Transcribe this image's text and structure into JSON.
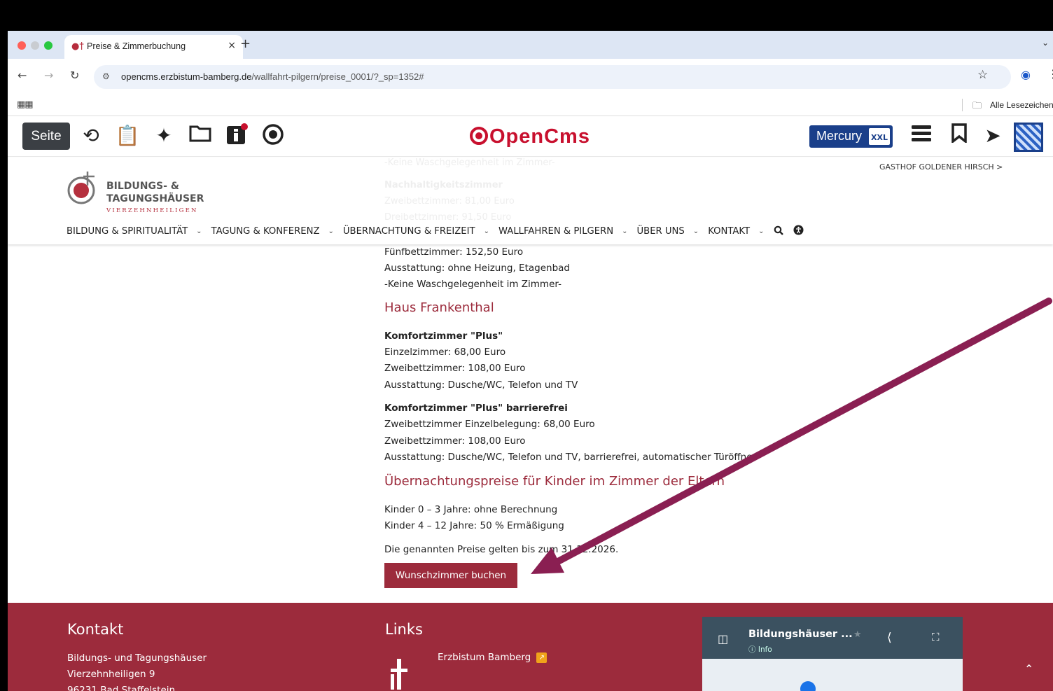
{
  "browser": {
    "tab_title": "Preise & Zimmerbuchung",
    "tab_close": "×",
    "new_tab": "+",
    "url_host": "opencms.erzbistum-bamberg.de",
    "url_path": "/wallfahrt-pilgern/preise_0001/?_sp=1352#",
    "bookmarks_label": "Alle Lesezeichen"
  },
  "cms_toolbar": {
    "seite_label": "Seite",
    "logo_text": "OpenCms",
    "mercury_label": "Mercury",
    "mercury_badge": "XXL"
  },
  "site_header": {
    "logo_line1": "BILDUNGS- &",
    "logo_line2": "TAGUNGSHÄUSER",
    "logo_line3": "VIERZEHNHEILIGEN",
    "gasthof_link": "GASTHOF GOLDENER HIRSCH >",
    "ghost_lines": [
      "-Keine Waschgelegenheit im Zimmer-",
      "Nachhaltigkeitszimmer",
      "Zweibettzimmer: 81,00 Euro",
      "Dreibettzimmer: 91,50 Euro"
    ],
    "nav": [
      "BILDUNG & SPIRITUALITÄT",
      "TAGUNG & KONFERENZ",
      "ÜBERNACHTUNG & FREIZEIT",
      "WALLFAHREN & PILGERN",
      "ÜBER UNS",
      "KONTAKT"
    ]
  },
  "content": {
    "line1": "Fünfbettzimmer: 152,50 Euro",
    "line2": "Ausstattung: ohne Heizung, Etagenbad",
    "line3": "-Keine Waschgelegenheit im Zimmer-",
    "heading_frankenthal": "Haus Frankenthal",
    "plus_title": "Komfortzimmer \"Plus\"",
    "plus_line1": "Einzelzimmer: 68,00 Euro",
    "plus_line2": "Zweibettzimmer: 108,00 Euro",
    "plus_line3": "Ausstattung: Dusche/WC, Telefon und TV",
    "bf_title": "Komfortzimmer \"Plus\" barrierefrei",
    "bf_line1": "Zweibettzimmer Einzelbelegung: 68,00 Euro",
    "bf_line2": "Zweibettzimmer: 108,00 Euro",
    "bf_line3": "Ausstattung: Dusche/WC, Telefon und TV, barrierefrei, automatischer Türöffner",
    "heading_kinder": "Übernachtungspreise für Kinder im Zimmer der Eltern",
    "kinder_line1": "Kinder 0 – 3 Jahre: ohne Berechnung",
    "kinder_line2": "Kinder 4 – 12 Jahre: 50 % Ermäßigung",
    "validity": "Die genannten Preise gelten bis zum 31.12.2026.",
    "book_button": "Wunschzimmer buchen"
  },
  "footer": {
    "kontakt_heading": "Kontakt",
    "addr1": "Bildungs- und Tagungshäuser",
    "addr2": "Vierzehnheiligen 9",
    "addr3": "96231 Bad Staffelstein",
    "links_heading": "Links",
    "link1": "Erzbistum Bamberg",
    "map_title": "Bildungshäuser ...",
    "map_info": "Info"
  },
  "colors": {
    "brand": "#9c2b3c",
    "opencms_red": "#c8102e",
    "mercury_blue": "#1a3f8a",
    "annotation_arrow": "#8a1f52"
  }
}
